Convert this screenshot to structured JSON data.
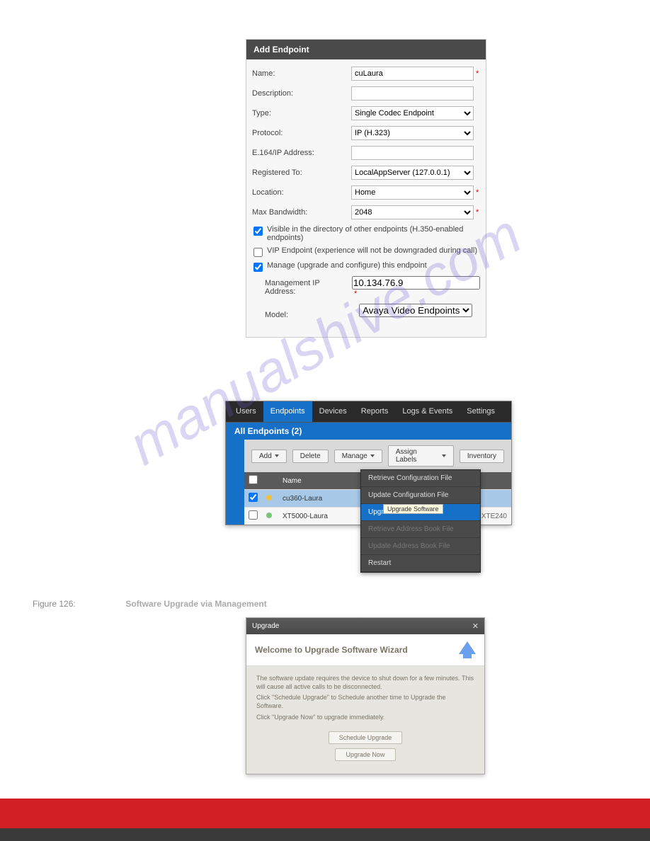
{
  "watermark": "manualshive.com",
  "form": {
    "title": "Add Endpoint",
    "fields": {
      "name": {
        "label": "Name:",
        "value": "cuLaura",
        "required": true
      },
      "description": {
        "label": "Description:",
        "value": "",
        "required": false
      },
      "type": {
        "label": "Type:",
        "value": "Single Codec Endpoint",
        "required": false
      },
      "protocol": {
        "label": "Protocol:",
        "value": "IP (H.323)",
        "required": false
      },
      "e164": {
        "label": "E.164/IP Address:",
        "value": "",
        "required": false
      },
      "registered": {
        "label": "Registered To:",
        "value": "LocalAppServer (127.0.0.1)",
        "required": false
      },
      "location": {
        "label": "Location:",
        "value": "Home",
        "required": true
      },
      "bandwidth": {
        "label": "Max Bandwidth:",
        "value": "2048",
        "required": true
      },
      "mgmt_ip": {
        "label": "Management IP Address:",
        "value": "10.134.76.9",
        "required": true
      },
      "model": {
        "label": "Model:",
        "value": "Avaya Video Endpoints",
        "required": false
      }
    },
    "checkboxes": {
      "visible": {
        "checked": true,
        "label": "Visible in the directory of other endpoints (H.350-enabled endpoints)"
      },
      "vip": {
        "checked": false,
        "label": "VIP Endpoint (experience will not be downgraded during call)"
      },
      "manage": {
        "checked": true,
        "label": "Manage (upgrade and configure) this endpoint"
      }
    }
  },
  "mgmt": {
    "tabs": [
      "Users",
      "Endpoints",
      "Devices",
      "Reports",
      "Logs & Events",
      "Settings"
    ],
    "active_tab": "Endpoints",
    "subtab": "All Endpoints (2)",
    "toolbar": {
      "add": "Add",
      "delete": "Delete",
      "manage": "Manage",
      "assign": "Assign Labels",
      "inventory": "Inventory"
    },
    "columns": {
      "name": "Name"
    },
    "rows": [
      {
        "selected": true,
        "name": "cu360-Laura",
        "right": ""
      },
      {
        "selected": false,
        "name": "XT5000-Laura",
        "right": "XTE240"
      }
    ],
    "menu": [
      {
        "label": "Retrieve Configuration File",
        "sel": false
      },
      {
        "label": "Update Configuration File",
        "sel": false
      },
      {
        "label": "Upgrade Software",
        "sel": true
      },
      {
        "label": "Retrieve Address Book File",
        "sel": false,
        "dim": true
      },
      {
        "label": "Update Address Book File",
        "sel": false,
        "dim": true
      },
      {
        "label": "Restart",
        "sel": false
      }
    ],
    "tooltip": "Upgrade Software"
  },
  "figure": {
    "label": "Figure 126:",
    "text": "Software Upgrade via Management"
  },
  "wizard": {
    "titlebar": "Upgrade",
    "heading": "Welcome to Upgrade Software Wizard",
    "line1": "The software update requires the device to shut down for a few minutes. This will cause all active calls to be disconnected.",
    "line2": "Click \"Schedule Upgrade\" to Schedule another time to Upgrade the Software.",
    "line3": "Click \"Upgrade Now\" to upgrade immediately.",
    "schedule_btn": "Schedule Upgrade",
    "now_btn": "Upgrade Now"
  }
}
